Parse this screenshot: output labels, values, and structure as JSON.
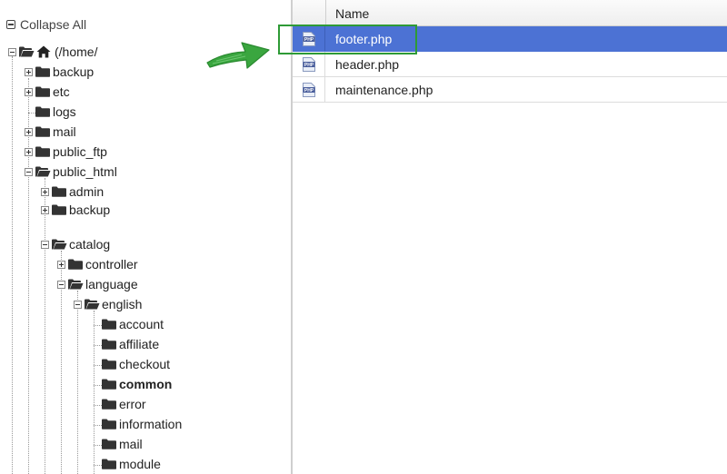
{
  "tree": {
    "collapse_all_label": "Collapse All",
    "root_label": "(/home/",
    "nodes": [
      {
        "label": "backup"
      },
      {
        "label": "etc"
      },
      {
        "label": "logs"
      },
      {
        "label": "mail"
      },
      {
        "label": "public_ftp"
      },
      {
        "label": "public_html"
      },
      {
        "label": "admin"
      },
      {
        "label": "backup"
      },
      {
        "label": "catalog"
      },
      {
        "label": "controller"
      },
      {
        "label": "language"
      },
      {
        "label": "english"
      },
      {
        "label": "account"
      },
      {
        "label": "affiliate"
      },
      {
        "label": "checkout"
      },
      {
        "label": "common"
      },
      {
        "label": "error"
      },
      {
        "label": "information"
      },
      {
        "label": "mail"
      },
      {
        "label": "module"
      }
    ]
  },
  "file_table": {
    "column_name_header": "Name",
    "rows": [
      {
        "name": "footer.php",
        "selected": true,
        "icon": "php-file-icon"
      },
      {
        "name": "header.php",
        "selected": false,
        "icon": "php-file-icon"
      },
      {
        "name": "maintenance.php",
        "selected": false,
        "icon": "php-file-icon"
      }
    ]
  },
  "colors": {
    "selected_row": "#4c72d4",
    "highlight_box": "#2e9a36",
    "arrow": "#3aa63f"
  }
}
